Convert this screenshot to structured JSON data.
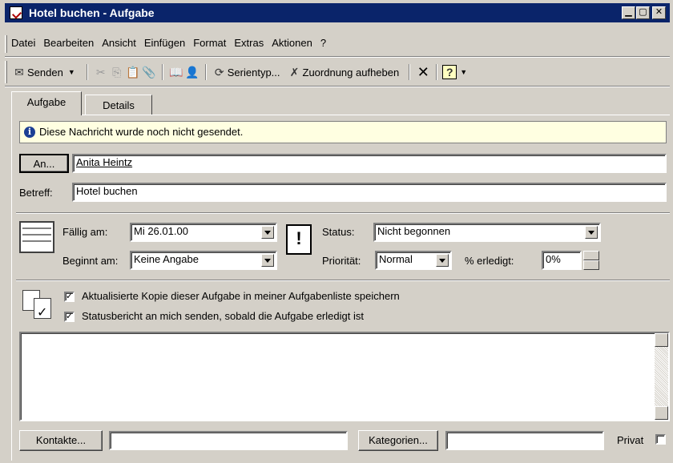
{
  "window": {
    "title": "Hotel buchen - Aufgabe",
    "min": "_",
    "max": "□",
    "close": "×"
  },
  "menu": [
    "Datei",
    "Bearbeiten",
    "Ansicht",
    "Einfügen",
    "Format",
    "Extras",
    "Aktionen",
    "?"
  ],
  "toolbar": {
    "send": "Senden",
    "recurrence": "Serientyp...",
    "unassign": "Zuordnung aufheben"
  },
  "tabs": [
    "Aufgabe",
    "Details"
  ],
  "info_message": "Diese Nachricht wurde noch nicht gesendet.",
  "to_button": "An...",
  "to_value": "Anita Heintz",
  "subject_label": "Betreff:",
  "subject_value": "Hotel buchen",
  "due_label": "Fällig am:",
  "due_value": "Mi 26.01.00",
  "start_label": "Beginnt am:",
  "start_value": "Keine Angabe",
  "status_label": "Status:",
  "status_value": "Nicht begonnen",
  "priority_label": "Priorität:",
  "priority_value": "Normal",
  "percent_label": "% erledigt:",
  "percent_value": "0%",
  "checkbox1": {
    "label": "Aktualisierte Kopie dieser Aufgabe in meiner Aufgabenliste speichern",
    "checked": true
  },
  "checkbox2": {
    "label": "Statusbericht an mich senden, sobald die Aufgabe erledigt ist",
    "checked": true
  },
  "notes_value": "",
  "contacts_button": "Kontakte...",
  "contacts_value": "",
  "categories_button": "Kategorien...",
  "categories_value": "",
  "private_label": "Privat",
  "private_checked": false
}
